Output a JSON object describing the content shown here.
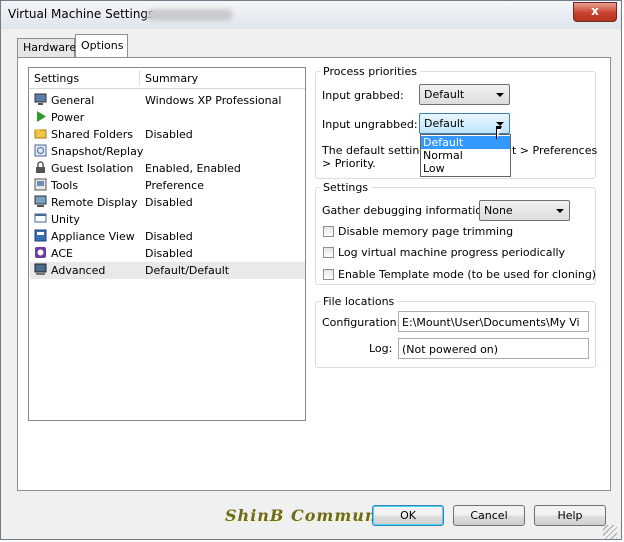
{
  "window": {
    "title": "Virtual Machine Settings",
    "close_glyph": "x"
  },
  "tabs": [
    {
      "label": "Hardware"
    },
    {
      "label": "Options"
    }
  ],
  "settings_list": {
    "headers": {
      "settings": "Settings",
      "summary": "Summary"
    },
    "rows": [
      {
        "label": "General",
        "summary": "Windows XP Professional",
        "icon": "monitor-icon"
      },
      {
        "label": "Power",
        "summary": "",
        "icon": "play-icon"
      },
      {
        "label": "Shared Folders",
        "summary": "Disabled",
        "icon": "folder-icon"
      },
      {
        "label": "Snapshot/Replay",
        "summary": "",
        "icon": "snapshot-icon"
      },
      {
        "label": "Guest Isolation",
        "summary": "Enabled, Enabled",
        "icon": "lock-icon"
      },
      {
        "label": "Tools",
        "summary": "Preference",
        "icon": "tools-icon"
      },
      {
        "label": "Remote Display",
        "summary": "Disabled",
        "icon": "remote-display-icon"
      },
      {
        "label": "Unity",
        "summary": "",
        "icon": "unity-icon"
      },
      {
        "label": "Appliance View",
        "summary": "Disabled",
        "icon": "appliance-icon"
      },
      {
        "label": "ACE",
        "summary": "Disabled",
        "icon": "ace-icon"
      },
      {
        "label": "Advanced",
        "summary": "Default/Default",
        "icon": "advanced-icon"
      }
    ]
  },
  "process_priorities": {
    "label": "Process priorities",
    "input_grabbed_label": "Input grabbed:",
    "input_grabbed_value": "Default",
    "input_ungrabbed_label": "Input ungrabbed:",
    "input_ungrabbed_value": "Default",
    "note_line1_start": "The default settings",
    "note_line1_end": "t > Preferences",
    "note_line2": "> Priority.",
    "dropdown_options": [
      "Default",
      "Normal",
      "Low"
    ]
  },
  "settings_group": {
    "label": "Settings",
    "debug_label": "Gather debugging information",
    "debug_value": "None",
    "checkboxes": [
      {
        "label": "Disable memory page trimming",
        "checked": false
      },
      {
        "label": "Log virtual machine progress periodically",
        "checked": false
      },
      {
        "label": "Enable Template mode (to be used for cloning)",
        "checked": false
      }
    ]
  },
  "file_locations": {
    "label": "File locations",
    "configuration_label": "Configuration:",
    "configuration_value": "E:\\Mount\\User\\Documents\\My Vi",
    "log_label": "Log:",
    "log_value": "(Not powered on)"
  },
  "buttons": {
    "ok": "OK",
    "cancel": "Cancel",
    "help": "Help"
  },
  "watermark": "ShinB  Community",
  "colors": {
    "selection": "#3399ff",
    "accent": "#3c7fb1",
    "close": "#c8412c"
  }
}
